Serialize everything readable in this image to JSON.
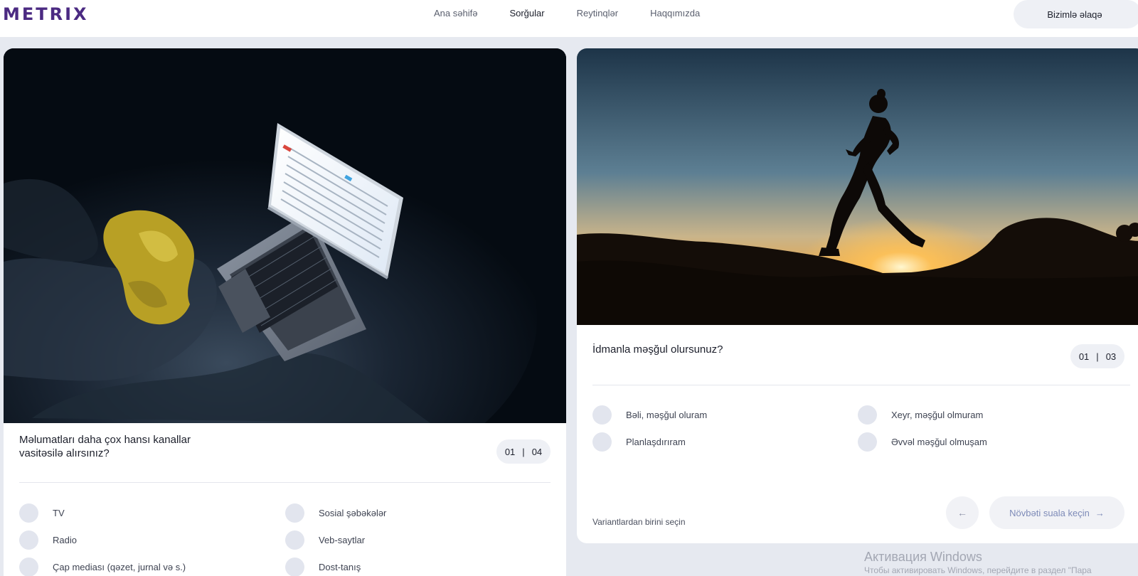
{
  "header": {
    "logo": "METRIX",
    "nav": [
      "Ana səhifə",
      "Sorğular",
      "Reytinqlər",
      "Haqqımızda"
    ],
    "active_nav": "Sorğular",
    "contact_label": "Bizimlə əlaqə"
  },
  "survey_left": {
    "question": "Məlumatları daha çox hansı kanallar vasitəsilə alırsınız?",
    "question_line1": "Məlumatları daha çox hansı kanallar",
    "question_line2": "vasitəsilə alırsınız?",
    "counter_current": "01",
    "counter_total": "04",
    "options": [
      "TV",
      "Sosial şəbəkələr",
      "Radio",
      "Veb-saytlar",
      "Çap mediası (qəzet, jurnal və s.)",
      "Dost-tanış"
    ]
  },
  "survey_right": {
    "question": "İdmanla məşğul olursunuz?",
    "counter_current": "01",
    "counter_total": "03",
    "options": [
      "Bəli, məşğul oluram",
      "Xeyr, məşğul olmuram",
      "Planlaşdırıram",
      "Əvvəl məşğul olmuşam"
    ],
    "hint": "Variantlardan birini seçin",
    "next_label": "Növbəti suala keçin"
  },
  "watermark": {
    "title": "Активация Windows",
    "subtitle": "Чтобы активировать Windows, перейдите в раздел \"Пара"
  },
  "colors": {
    "background": "#e6e9f0",
    "card": "#ffffff",
    "radio": "#e2e5ee",
    "logo": "#4b2a82"
  },
  "icons": {
    "prev": "arrow-left-icon",
    "next": "arrow-right-icon"
  }
}
